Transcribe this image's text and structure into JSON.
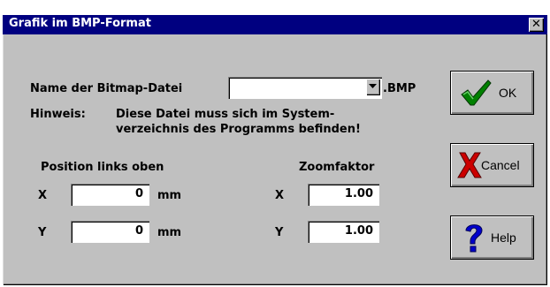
{
  "window": {
    "title": "Grafik im BMP-Format",
    "close_glyph": "✕"
  },
  "bitmap": {
    "label": "Name der Bitmap-Datei",
    "value": "",
    "extension": ".BMP"
  },
  "hint": {
    "label": "Hinweis:",
    "line1": "Diese Datei muss sich im System-",
    "line2": "verzeichnis des Programms befinden!"
  },
  "position": {
    "heading": "Position links oben",
    "x_label": "X",
    "x_value": "0",
    "y_label": "Y",
    "y_value": "0",
    "unit": "mm"
  },
  "zoom": {
    "heading": "Zoomfaktor",
    "x_label": "X",
    "x_value": "1.00",
    "y_label": "Y",
    "y_value": "1.00"
  },
  "buttons": {
    "ok": "OK",
    "cancel": "Cancel",
    "help": "Help"
  },
  "icons": {
    "ok": "green-checkmark-icon",
    "cancel": "red-x-icon",
    "help": "blue-question-mark-icon",
    "combo": "dropdown-arrow-icon"
  },
  "colors": {
    "titlebar": "#000080",
    "face": "#c0c0c0",
    "check": "#008000",
    "cross": "#cc0000",
    "help": "#0000cc"
  }
}
